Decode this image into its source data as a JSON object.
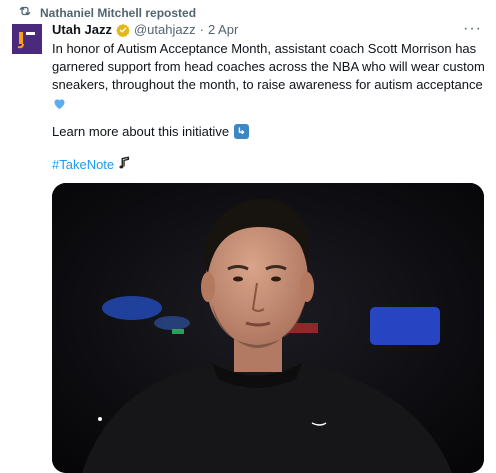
{
  "repost": {
    "icon": "repost-icon",
    "text": "Nathaniel Mitchell reposted"
  },
  "tweet": {
    "author_name": "Utah Jazz",
    "verified_icon": "verified-badge-icon",
    "handle": "@utahjazz",
    "separator": "·",
    "date": "2 Apr",
    "more_icon": "more-options-icon",
    "more_label": "···",
    "body": "In honor of Autism Acceptance Month, assistant coach Scott Morrison has garnered support from head coaches across the NBA who will wear custom sneakers, throughout the month, to raise awareness for autism acceptance",
    "emoji_heart": "light-blue-heart-icon",
    "learn_more": "Learn more about this initiative",
    "learn_more_icon": "arrow-down-right-icon",
    "hashtag": "#TakeNote",
    "hashtag_icon": "music-note-icon",
    "media_description_icon": "photo-coach-icon"
  },
  "colors": {
    "accent": "#1d9bf0",
    "muted": "#536471",
    "avatar_bg": "#4b2a7d",
    "gold_badge": "#e2b719"
  }
}
